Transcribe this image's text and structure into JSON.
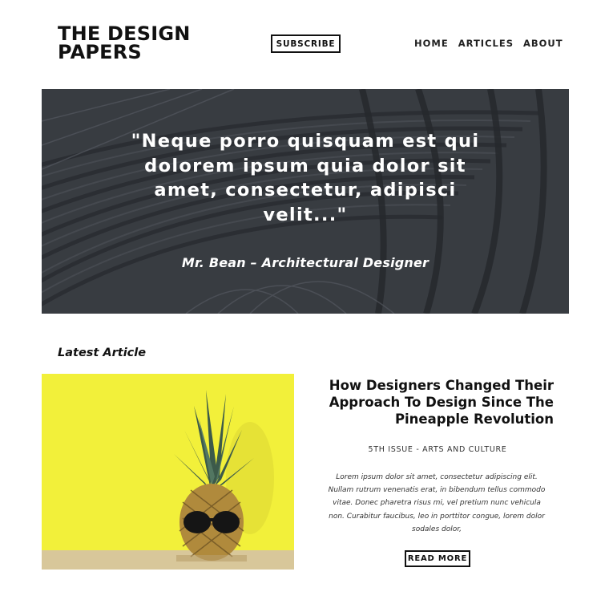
{
  "header": {
    "logo": "THE DESIGN\nPAPERS",
    "subscribe_label": "SUBSCRIBE",
    "nav": [
      {
        "label": "HOME"
      },
      {
        "label": "ARTICLES"
      },
      {
        "label": "ABOUT"
      }
    ]
  },
  "hero": {
    "quote": "\"Neque porro quisquam est qui dolorem ipsum quia dolor sit amet, consectetur, adipisci velit...\"",
    "attribution": "Mr. Bean – Architectural Designer"
  },
  "latest": {
    "section_title": "Latest Article",
    "title": "How Designers Changed Their Approach To Design Since The Pineapple Revolution",
    "meta": "5TH ISSUE - ARTS AND CULTURE",
    "excerpt": "Lorem ipsum dolor sit amet, consectetur adipiscing elit. Nullam rutrum venenatis erat, in bibendum tellus commodo vitae. Donec pharetra risus mi, vel pretium nunc vehicula non. Curabitur faucibus, leo in porttitor congue, lorem dolor sodales dolor,",
    "read_more_label": "READ MORE"
  },
  "colors": {
    "hero_overlay": "#3f4349",
    "image_background": "#f2f03a",
    "text": "#111111"
  },
  "icons": {
    "hero_image": "architecture-photo",
    "article_image": "pineapple-sunglasses-photo"
  }
}
